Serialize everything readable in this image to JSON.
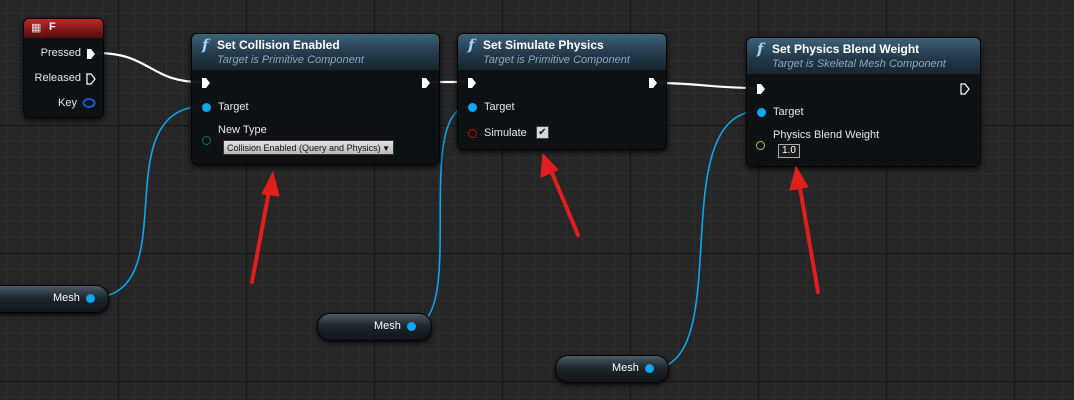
{
  "event_node": {
    "title": "F",
    "icon": "keyboard-icon",
    "pins": {
      "pressed": "Pressed",
      "released": "Released",
      "key": "Key"
    }
  },
  "collision_node": {
    "title": "Set Collision Enabled",
    "subtitle": "Target is Primitive Component",
    "target_label": "Target",
    "new_type_label": "New Type",
    "new_type_value": "Collision Enabled (Query and Physics)"
  },
  "simulate_node": {
    "title": "Set Simulate Physics",
    "subtitle": "Target is Primitive Component",
    "target_label": "Target",
    "simulate_label": "Simulate",
    "simulate_checked": true,
    "check_glyph": "✔"
  },
  "blend_node": {
    "title": "Set Physics Blend Weight",
    "subtitle": "Target is Skeletal Mesh Component",
    "target_label": "Target",
    "weight_label": "Physics Blend Weight",
    "weight_value": "1.0"
  },
  "mesh_nodes": [
    {
      "label": "Mesh"
    },
    {
      "label": "Mesh"
    },
    {
      "label": "Mesh"
    }
  ],
  "colors": {
    "exec": "#ffffff",
    "object_pin": "#0da6ef",
    "collision_enum_pin": "#0d6e52",
    "bool_pin": "#8c0000",
    "float_pin": "#8ad645",
    "annotation_arrow": "#e01e1e"
  }
}
